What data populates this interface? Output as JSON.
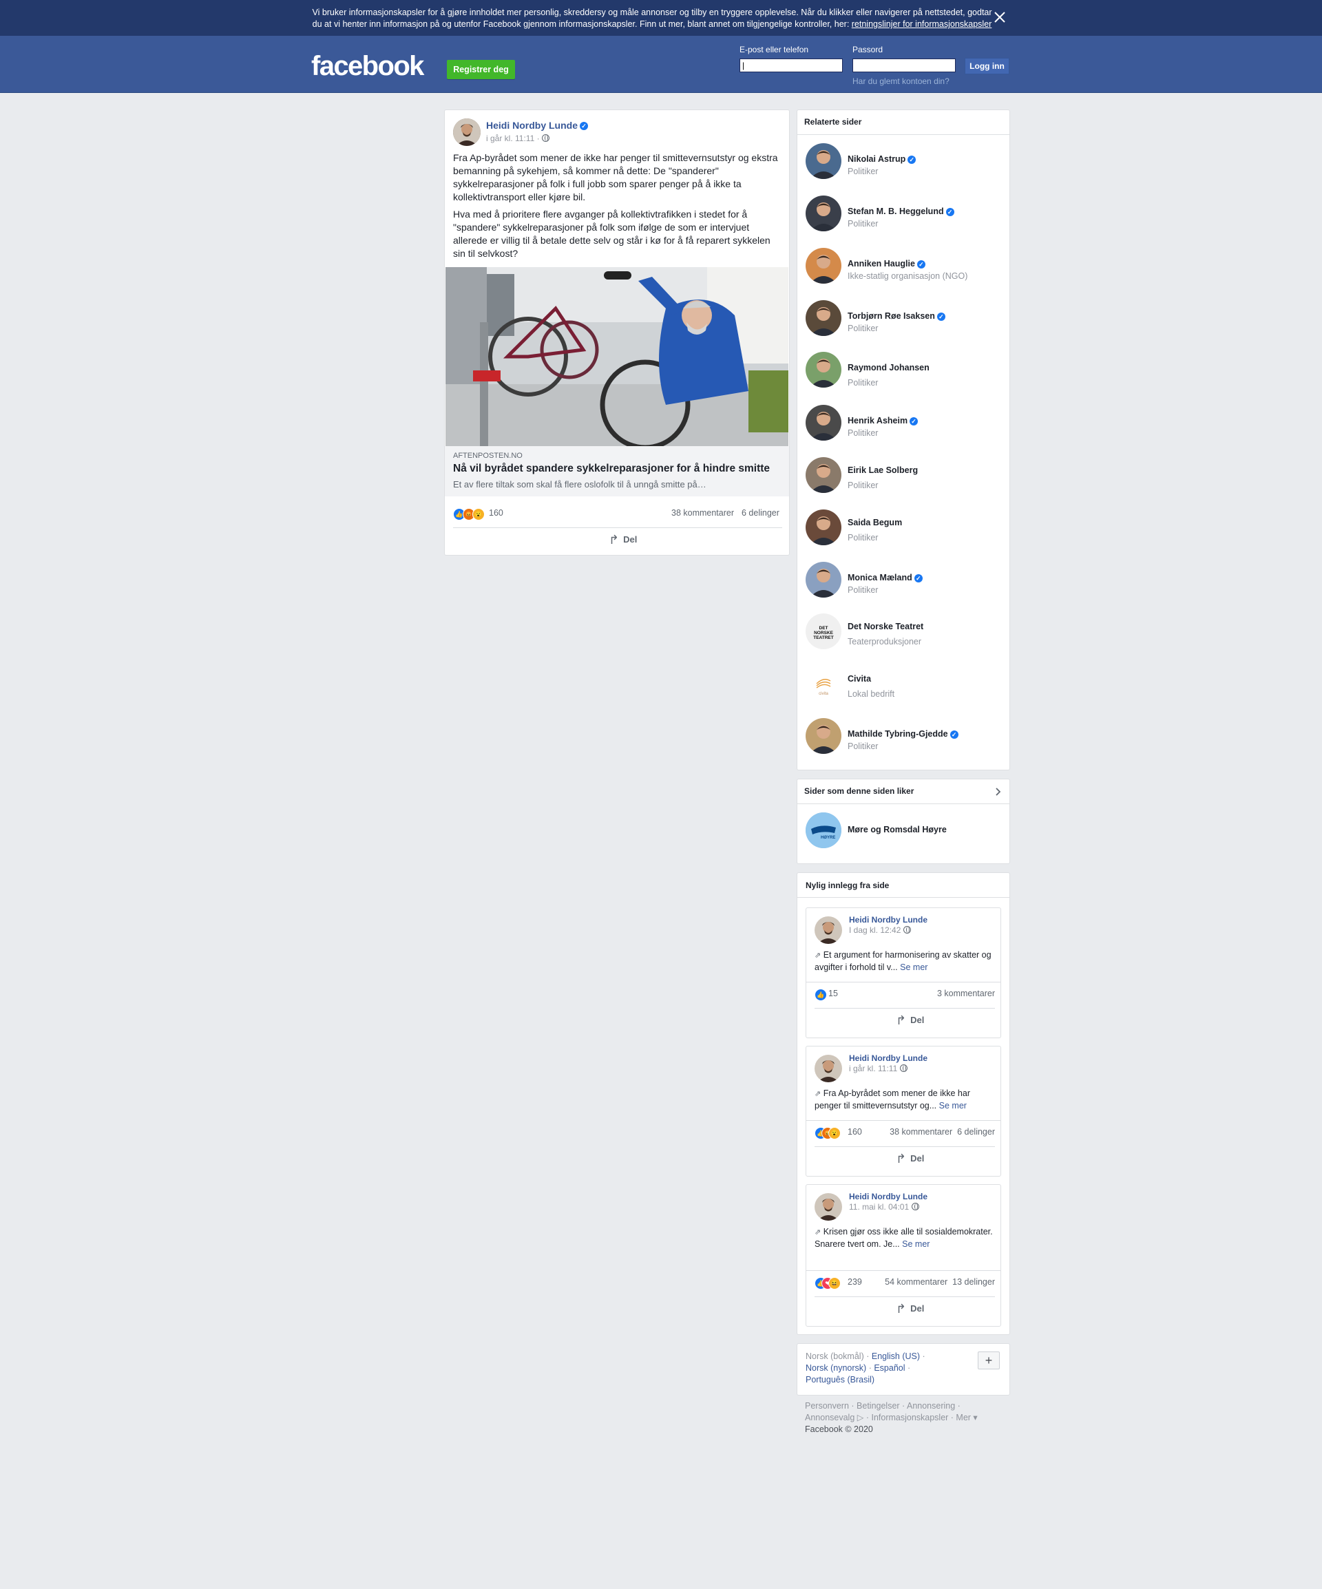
{
  "cookie_banner": {
    "text": "Vi bruker informasjonskapsler for å gjøre innholdet mer personlig, skreddersy og måle annonser og tilby en tryggere opplevelse. Når du klikker eller navigerer på nettstedet, godtar du at vi henter inn informasjon på og utenfor Facebook gjennom informasjonskapsler. Finn ut mer, blant annet om tilgjengelige kontroller, her: ",
    "link": "retningslinjer for informasjonskapsler"
  },
  "header": {
    "logo": "facebook",
    "register": "Registrer deg",
    "email_label": "E-post eller telefon",
    "email_value": "|",
    "password_label": "Passord",
    "login": "Logg inn",
    "forgot": "Har du glemt kontoen din?"
  },
  "post": {
    "author": "Heidi Nordby Lunde",
    "time": "i går kl. 11:11 ·",
    "paragraph1": "Fra Ap-byrådet som mener de ikke har penger til smittevernsutstyr og ekstra bemanning på sykehjem, så kommer nå dette: De \"spanderer\" sykkelreparasjoner på folk i full jobb som sparer penger på å ikke ta kollektivtransport eller kjøre bil.",
    "paragraph2": "Hva med å prioritere flere avganger på kollektivtrafikken i stedet for å \"spandere\" sykkelreparasjoner på folk som ifølge de som er intervjuet allerede er villig til å betale dette selv og står i kø for å få reparert sykkelen sin til selvkost?",
    "link_domain": "AFTENPOSTEN.NO",
    "link_title": "Nå vil byrådet spandere sykkelreparasjoner for å hindre smitte",
    "link_desc": "Et av flere tiltak som skal få flere oslofolk til å unngå smitte på…",
    "reactions": "160",
    "comments": "38 kommentarer",
    "shares": "6 delinger",
    "share": "Del"
  },
  "related": {
    "title": "Relaterte sider",
    "items": [
      {
        "name": "Nikolai Astrup",
        "category": "Politiker",
        "verified": true,
        "color": "#4a6a8f"
      },
      {
        "name": "Stefan M. B. Heggelund",
        "category": "Politiker",
        "verified": true,
        "color": "#3a3f4a"
      },
      {
        "name": "Anniken Hauglie",
        "category": "Ikke-statlig organisasjon (NGO)",
        "verified": true,
        "color": "#d48a4a"
      },
      {
        "name": "Torbjørn Røe Isaksen",
        "category": "Politiker",
        "verified": true,
        "color": "#5a4a3a"
      },
      {
        "name": "Raymond Johansen",
        "category": "Politiker",
        "verified": false,
        "color": "#7aa06a"
      },
      {
        "name": "Henrik Asheim",
        "category": "Politiker",
        "verified": true,
        "color": "#4a4a4a"
      },
      {
        "name": "Eirik Lae Solberg",
        "category": "Politiker",
        "verified": false,
        "color": "#8a7a6a"
      },
      {
        "name": "Saida Begum",
        "category": "Politiker",
        "verified": false,
        "color": "#6a4a3a"
      },
      {
        "name": "Monica Mæland",
        "category": "Politiker",
        "verified": true,
        "color": "#8aa0c0"
      },
      {
        "name": "Det Norske Teatret",
        "category": "Teaterproduksjoner",
        "verified": false,
        "color": "#f0f0f0"
      },
      {
        "name": "Civita",
        "category": "Lokal bedrift",
        "verified": false,
        "color": "#ffffff"
      },
      {
        "name": "Mathilde Tybring-Gjedde",
        "category": "Politiker",
        "verified": true,
        "color": "#c0a070"
      }
    ],
    "teatret_logo": "DET NORSKE TEATRET",
    "civita_logo": "civita"
  },
  "likes": {
    "title": "Sider som denne siden liker",
    "page": "Møre og Romsdal Høyre",
    "logo_text": "HØYRE"
  },
  "recent": {
    "title": "Nylig innlegg fra side",
    "see_more": "Se mer",
    "share": "Del",
    "posts": [
      {
        "author": "Heidi Nordby Lunde",
        "time": "I dag kl. 12:42",
        "text": "Et argument for harmonisering av skatter og avgifter i forhold til v...",
        "reactions": "15",
        "comments": "3 kommentarer",
        "shares": ""
      },
      {
        "author": "Heidi Nordby Lunde",
        "time": "i går kl. 11:11",
        "text": "Fra Ap-byrådet som mener de ikke har penger til smittevernsutstyr og...",
        "reactions": "160",
        "comments": "38 kommentarer",
        "shares": "6 delinger"
      },
      {
        "author": "Heidi Nordby Lunde",
        "time": "11. mai kl. 04:01",
        "text": "Krisen gjør oss ikke alle til sosialdemokrater. Snarere tvert om. Je...",
        "reactions": "239",
        "comments": "54 kommentarer",
        "shares": "13 delinger"
      }
    ]
  },
  "languages": {
    "current": "Norsk (bokmål)",
    "english": "English (US)",
    "nynorsk": "Norsk (nynorsk)",
    "espanol": "Español",
    "portugues": "Português (Brasil)",
    "more": "+"
  },
  "footer": {
    "line1": "Personvern · Betingelser · Annonsering ·",
    "line2": "Annonsevalg ▷ · Informasjonskapsler · Mer ▾",
    "line3": "Facebook © 2020"
  }
}
